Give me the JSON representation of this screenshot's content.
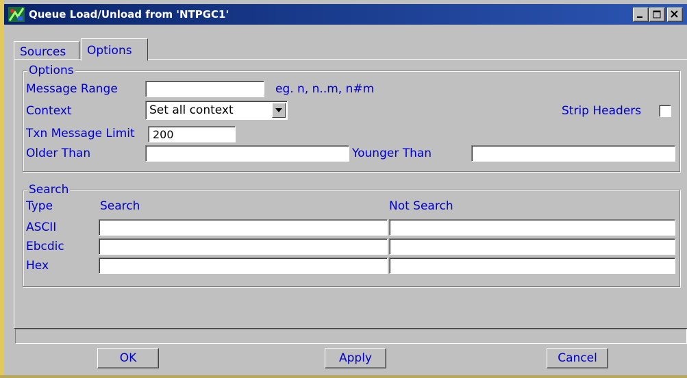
{
  "window": {
    "title": "Queue Load/Unload from 'NTPGC1'",
    "buttons": [
      "minimize",
      "maximize",
      "close"
    ]
  },
  "tabs": [
    {
      "label": "Sources",
      "selected": false
    },
    {
      "label": "Options",
      "selected": true
    }
  ],
  "options": {
    "legend": "Options",
    "message_range": {
      "label": "Message Range",
      "value": "",
      "hint": "eg. n, n..m, n#m"
    },
    "context": {
      "label": "Context",
      "selected": "Set all context"
    },
    "strip_headers": {
      "label": "Strip Headers",
      "checked": false
    },
    "txn_message_limit": {
      "label": "Txn Message Limit",
      "value": "200"
    },
    "older_than": {
      "label": "Older Than",
      "value": ""
    },
    "younger_than": {
      "label": "Younger Than",
      "value": ""
    }
  },
  "search": {
    "legend": "Search",
    "col_type": "Type",
    "col_search": "Search",
    "col_not_search": "Not Search",
    "rows": [
      {
        "type": "ASCII",
        "search": "",
        "not_search": ""
      },
      {
        "type": "Ebcdic",
        "search": "",
        "not_search": ""
      },
      {
        "type": "Hex",
        "search": "",
        "not_search": ""
      }
    ]
  },
  "status_text": "",
  "buttons": {
    "ok": "OK",
    "apply": "Apply",
    "cancel": "Cancel"
  },
  "colors": {
    "label": "#0000cc",
    "title_bar": "#0a246a",
    "face": "#c0c0c0"
  }
}
